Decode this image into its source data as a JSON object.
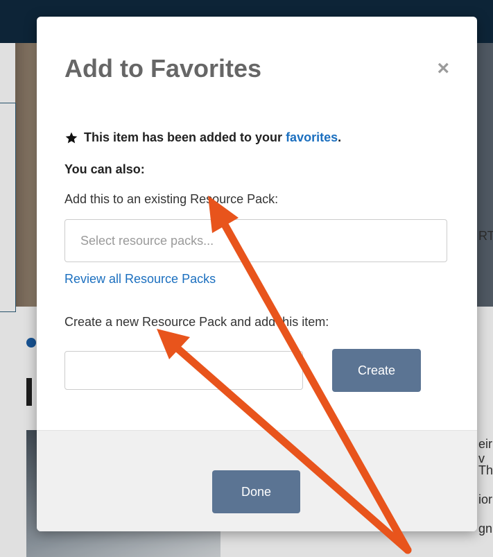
{
  "background": {
    "right_text_fragments": [
      "RTI",
      "eir v",
      "The",
      "ior",
      "gn"
    ]
  },
  "modal": {
    "title": "Add to Favorites",
    "close_label": "×",
    "added_prefix": "This item has been added to your ",
    "added_link": "favorites",
    "added_suffix": ".",
    "you_can_also": "You can also:",
    "existing_label": "Add this to an existing Resource Pack:",
    "select_placeholder": "Select resource packs...",
    "review_link": "Review all Resource Packs",
    "create_label": "Create a new Resource Pack and add this item:",
    "new_pack_value": "",
    "create_button": "Create",
    "done_button": "Done"
  },
  "colors": {
    "annotation_arrow": "#e8541c",
    "primary_button": "#5b7493",
    "link": "#1b6fbf"
  }
}
